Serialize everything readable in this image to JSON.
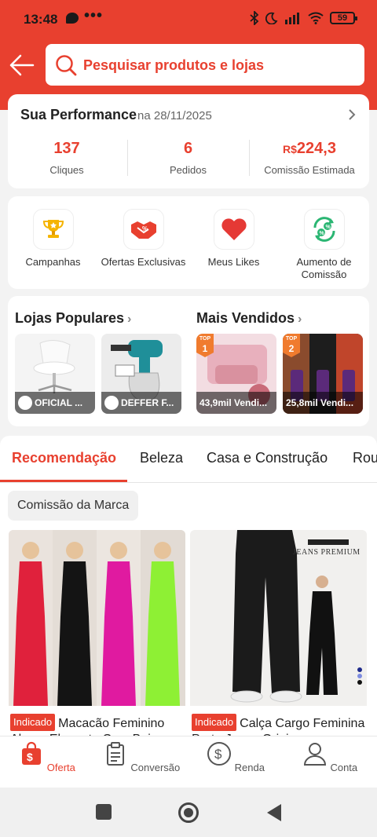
{
  "status_bar": {
    "time": "13:48",
    "dots": "•••",
    "battery": "59"
  },
  "search": {
    "placeholder": "Pesquisar produtos e lojas"
  },
  "performance": {
    "title": "Sua Performance",
    "date": "na 28/11/2025",
    "stats": [
      {
        "value": "137",
        "label": "Cliques"
      },
      {
        "value": "6",
        "label": "Pedidos"
      },
      {
        "currency": "R$",
        "value": "224,3",
        "label": "Comissão Estimada"
      }
    ]
  },
  "quick_links": [
    {
      "label": "Campanhas",
      "icon": "trophy-icon"
    },
    {
      "label": "Ofertas Exclusivas",
      "icon": "handshake-icon"
    },
    {
      "label": "Meus Likes",
      "icon": "heart-icon"
    },
    {
      "label": "Aumento de Comissão",
      "icon": "percent-cycle-icon"
    }
  ],
  "popular_stores": {
    "title": "Lojas Populares",
    "arrow": "›",
    "items": [
      {
        "label": "OFICIAL ..."
      },
      {
        "label": "DEFFER F..."
      }
    ]
  },
  "best_sellers": {
    "title": "Mais Vendidos",
    "arrow": "›",
    "items": [
      {
        "badge_top": "TOP",
        "rank": "1",
        "label": "43,9mil Vendi..."
      },
      {
        "badge_top": "TOP",
        "rank": "2",
        "label": "25,8mil Vendi..."
      }
    ]
  },
  "tabs": [
    "Recomendação",
    "Beleza",
    "Casa e Construção",
    "Rou"
  ],
  "filter_chip": "Comissão da Marca",
  "products": [
    {
      "tag": "Indicado",
      "title": "Macacão Feminino Alona, Elegante Com Bojo"
    },
    {
      "tag": "Indicado",
      "title": "Calça Cargo Feminina Preta Jeans Origi",
      "overlay": "JEANS PREMIUM"
    }
  ],
  "bottom_nav": [
    {
      "label": "Oferta",
      "icon": "shopping-bag-icon",
      "active": true
    },
    {
      "label": "Conversão",
      "icon": "clipboard-icon",
      "active": false
    },
    {
      "label": "Renda",
      "icon": "dollar-circle-icon",
      "active": false
    },
    {
      "label": "Conta",
      "icon": "user-icon",
      "active": false
    }
  ],
  "colors": {
    "accent": "#e8402f",
    "background": "#f3f3f3"
  }
}
